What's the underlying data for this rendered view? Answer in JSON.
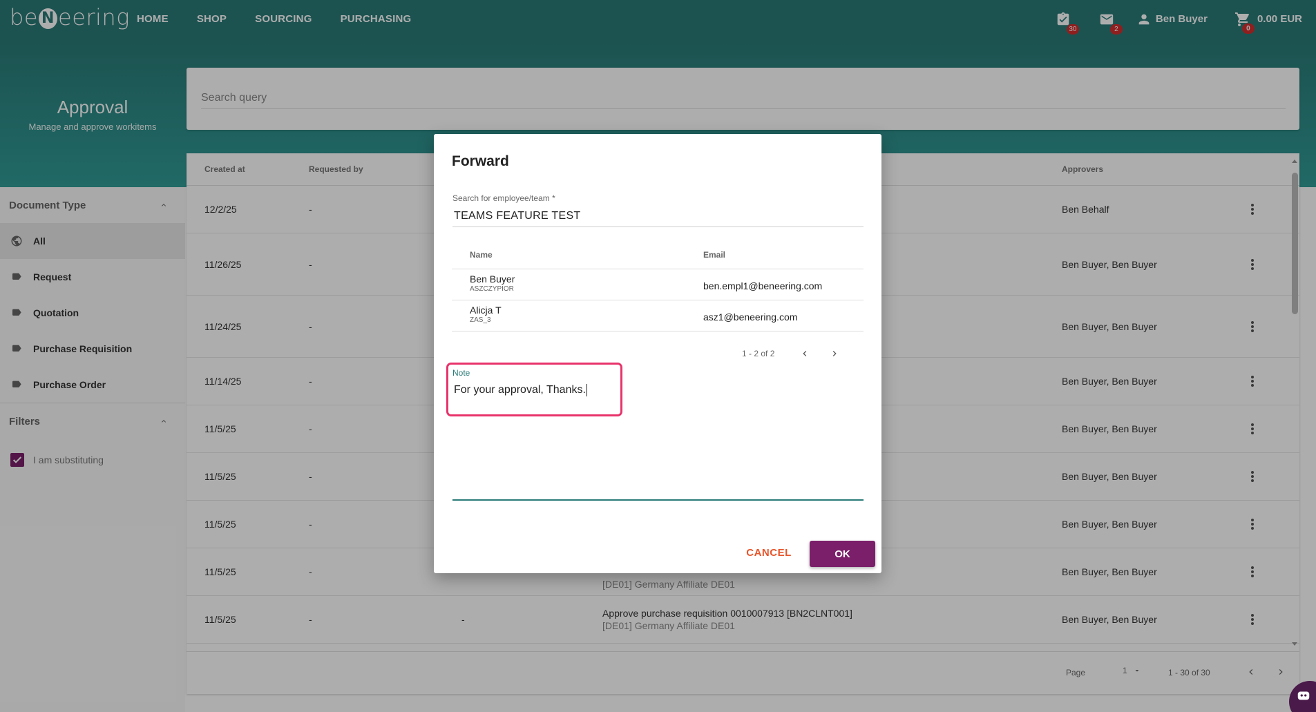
{
  "brand": {
    "logo_text": "be eering",
    "logo_mark": "N"
  },
  "nav": {
    "items": [
      "HOME",
      "SHOP",
      "SOURCING",
      "PURCHASING"
    ]
  },
  "header": {
    "tasks_badge": "30",
    "messages_badge": "2",
    "user_name": "Ben Buyer",
    "cart_badge": "0",
    "cart_total": "0.00 EUR"
  },
  "page": {
    "title": "Approval",
    "subtitle": "Manage and approve workitems"
  },
  "search": {
    "placeholder": "Search query"
  },
  "sidebar": {
    "document_type_label": "Document Type",
    "items": [
      "All",
      "Request",
      "Quotation",
      "Purchase Requisition",
      "Purchase Order"
    ],
    "filters_label": "Filters",
    "substituting_label": "I am substituting"
  },
  "table": {
    "headers": {
      "created_at": "Created at",
      "requested_by": "Requested by",
      "approvers": "Approvers"
    },
    "rows": [
      {
        "created": "12/2/25",
        "requested_by": "-",
        "approvers": "Ben Behalf"
      },
      {
        "created": "11/26/25",
        "requested_by": "-",
        "approvers": "Ben Buyer, Ben Buyer"
      },
      {
        "created": "11/24/25",
        "requested_by": "-",
        "approvers": "Ben Buyer, Ben Buyer"
      },
      {
        "created": "11/14/25",
        "requested_by": "-",
        "approvers": "Ben Buyer, Ben Buyer"
      },
      {
        "created": "11/5/25",
        "requested_by": "-",
        "approvers": "Ben Buyer, Ben Buyer"
      },
      {
        "created": "11/5/25",
        "requested_by": "-",
        "approvers": "Ben Buyer, Ben Buyer"
      },
      {
        "created": "11/5/25",
        "requested_by": "-",
        "approvers": "Ben Buyer, Ben Buyer"
      },
      {
        "created": "11/5/25",
        "requested_by": "-",
        "approvers": "Ben Buyer, Ben Buyer",
        "desc2": "[DE01] Germany Affiliate DE01"
      },
      {
        "created": "11/5/25",
        "requested_by": "-",
        "third": "-",
        "approvers": "Ben Buyer, Ben Buyer",
        "desc1": "Approve purchase requisition 0010007913 [BN2CLNT001]",
        "desc2": "[DE01] Germany Affiliate DE01"
      }
    ],
    "footer": {
      "page_label": "Page",
      "page_value": "1",
      "range": "1 - 30 of 30"
    }
  },
  "dialog": {
    "title": "Forward",
    "employee_label": "Search for employee/team",
    "employee_required": "*",
    "employee_value": "TEAMS FEATURE TEST",
    "headers": {
      "name": "Name",
      "email": "Email"
    },
    "rows": [
      {
        "name": "Ben Buyer",
        "code": "ASZCZYPIOR",
        "email": "ben.empl1@beneering.com"
      },
      {
        "name": "Alicja T",
        "code": "ZAS_3",
        "email": "asz1@beneering.com"
      }
    ],
    "pager": "1 - 2 of 2",
    "note_label": "Note",
    "note_value": "For your approval, Thanks.",
    "cancel_label": "CANCEL",
    "ok_label": "OK"
  },
  "colors": {
    "primary": "#2a7b78",
    "accent": "#7b1f6a",
    "cancel": "#e8552a",
    "highlight": "#e8336b"
  }
}
